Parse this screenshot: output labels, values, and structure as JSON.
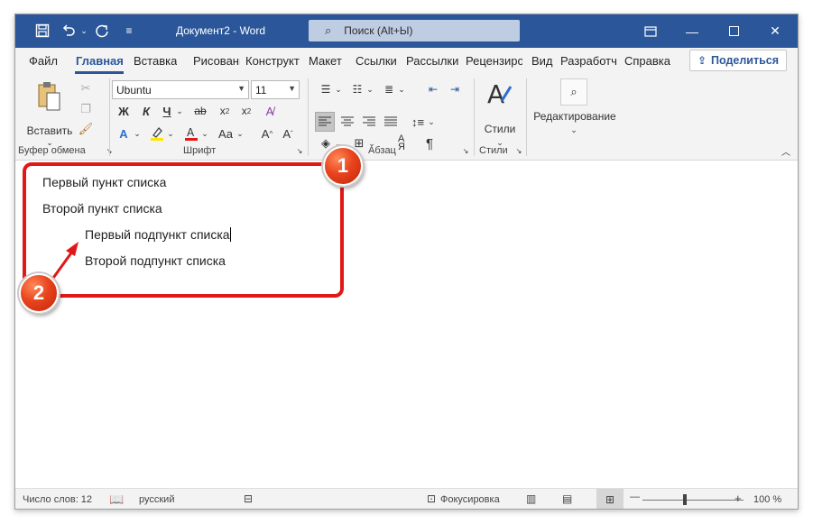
{
  "titlebar": {
    "doc_title": "Документ2  -  Word",
    "search_placeholder": "Поиск (Alt+Ы)"
  },
  "tabs": [
    "Файл",
    "Главная",
    "Вставка",
    "Рисование",
    "Конструкт",
    "Макет",
    "Ссылки",
    "Рассылки",
    "Рецензиро",
    "Вид",
    "Разработч",
    "Справка"
  ],
  "share_label": "Поделиться",
  "ribbon": {
    "clipboard": {
      "paste_label": "Вставить",
      "group_label": "Буфер обмена"
    },
    "font": {
      "font_name": "Ubuntu",
      "font_size": "11",
      "bold": "Ж",
      "italic": "К",
      "underline": "Ч",
      "group_label": "Шрифт"
    },
    "paragraph": {
      "group_label": "Абзац"
    },
    "styles": {
      "label": "Стили",
      "group_label": "Стили"
    },
    "editing": {
      "label": "Редактирование"
    }
  },
  "document": {
    "lines": [
      "Первый пункт списка",
      "Второй пункт списка",
      "Первый подпункт списка",
      "Второй подпункт списка"
    ]
  },
  "statusbar": {
    "word_count": "Число слов: 12",
    "language": "русский",
    "focus": "Фокусировка",
    "zoom": "100 %"
  },
  "badges": [
    "1",
    "2"
  ],
  "colors": {
    "accent": "#2b579a",
    "annotation": "#e01818"
  }
}
